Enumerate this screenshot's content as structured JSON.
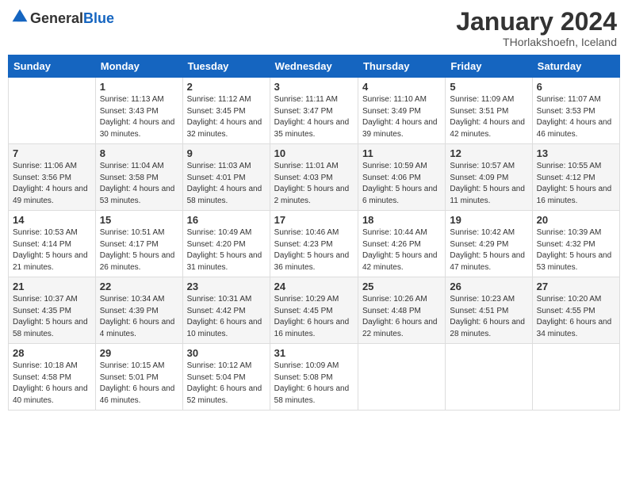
{
  "header": {
    "logo_general": "General",
    "logo_blue": "Blue",
    "month_title": "January 2024",
    "subtitle": "THorlakshoefn, Iceland"
  },
  "weekdays": [
    "Sunday",
    "Monday",
    "Tuesday",
    "Wednesday",
    "Thursday",
    "Friday",
    "Saturday"
  ],
  "weeks": [
    [
      {
        "day": "",
        "sunrise": "",
        "sunset": "",
        "daylight": ""
      },
      {
        "day": "1",
        "sunrise": "Sunrise: 11:13 AM",
        "sunset": "Sunset: 3:43 PM",
        "daylight": "Daylight: 4 hours and 30 minutes."
      },
      {
        "day": "2",
        "sunrise": "Sunrise: 11:12 AM",
        "sunset": "Sunset: 3:45 PM",
        "daylight": "Daylight: 4 hours and 32 minutes."
      },
      {
        "day": "3",
        "sunrise": "Sunrise: 11:11 AM",
        "sunset": "Sunset: 3:47 PM",
        "daylight": "Daylight: 4 hours and 35 minutes."
      },
      {
        "day": "4",
        "sunrise": "Sunrise: 11:10 AM",
        "sunset": "Sunset: 3:49 PM",
        "daylight": "Daylight: 4 hours and 39 minutes."
      },
      {
        "day": "5",
        "sunrise": "Sunrise: 11:09 AM",
        "sunset": "Sunset: 3:51 PM",
        "daylight": "Daylight: 4 hours and 42 minutes."
      },
      {
        "day": "6",
        "sunrise": "Sunrise: 11:07 AM",
        "sunset": "Sunset: 3:53 PM",
        "daylight": "Daylight: 4 hours and 46 minutes."
      }
    ],
    [
      {
        "day": "7",
        "sunrise": "Sunrise: 11:06 AM",
        "sunset": "Sunset: 3:56 PM",
        "daylight": "Daylight: 4 hours and 49 minutes."
      },
      {
        "day": "8",
        "sunrise": "Sunrise: 11:04 AM",
        "sunset": "Sunset: 3:58 PM",
        "daylight": "Daylight: 4 hours and 53 minutes."
      },
      {
        "day": "9",
        "sunrise": "Sunrise: 11:03 AM",
        "sunset": "Sunset: 4:01 PM",
        "daylight": "Daylight: 4 hours and 58 minutes."
      },
      {
        "day": "10",
        "sunrise": "Sunrise: 11:01 AM",
        "sunset": "Sunset: 4:03 PM",
        "daylight": "Daylight: 5 hours and 2 minutes."
      },
      {
        "day": "11",
        "sunrise": "Sunrise: 10:59 AM",
        "sunset": "Sunset: 4:06 PM",
        "daylight": "Daylight: 5 hours and 6 minutes."
      },
      {
        "day": "12",
        "sunrise": "Sunrise: 10:57 AM",
        "sunset": "Sunset: 4:09 PM",
        "daylight": "Daylight: 5 hours and 11 minutes."
      },
      {
        "day": "13",
        "sunrise": "Sunrise: 10:55 AM",
        "sunset": "Sunset: 4:12 PM",
        "daylight": "Daylight: 5 hours and 16 minutes."
      }
    ],
    [
      {
        "day": "14",
        "sunrise": "Sunrise: 10:53 AM",
        "sunset": "Sunset: 4:14 PM",
        "daylight": "Daylight: 5 hours and 21 minutes."
      },
      {
        "day": "15",
        "sunrise": "Sunrise: 10:51 AM",
        "sunset": "Sunset: 4:17 PM",
        "daylight": "Daylight: 5 hours and 26 minutes."
      },
      {
        "day": "16",
        "sunrise": "Sunrise: 10:49 AM",
        "sunset": "Sunset: 4:20 PM",
        "daylight": "Daylight: 5 hours and 31 minutes."
      },
      {
        "day": "17",
        "sunrise": "Sunrise: 10:46 AM",
        "sunset": "Sunset: 4:23 PM",
        "daylight": "Daylight: 5 hours and 36 minutes."
      },
      {
        "day": "18",
        "sunrise": "Sunrise: 10:44 AM",
        "sunset": "Sunset: 4:26 PM",
        "daylight": "Daylight: 5 hours and 42 minutes."
      },
      {
        "day": "19",
        "sunrise": "Sunrise: 10:42 AM",
        "sunset": "Sunset: 4:29 PM",
        "daylight": "Daylight: 5 hours and 47 minutes."
      },
      {
        "day": "20",
        "sunrise": "Sunrise: 10:39 AM",
        "sunset": "Sunset: 4:32 PM",
        "daylight": "Daylight: 5 hours and 53 minutes."
      }
    ],
    [
      {
        "day": "21",
        "sunrise": "Sunrise: 10:37 AM",
        "sunset": "Sunset: 4:35 PM",
        "daylight": "Daylight: 5 hours and 58 minutes."
      },
      {
        "day": "22",
        "sunrise": "Sunrise: 10:34 AM",
        "sunset": "Sunset: 4:39 PM",
        "daylight": "Daylight: 6 hours and 4 minutes."
      },
      {
        "day": "23",
        "sunrise": "Sunrise: 10:31 AM",
        "sunset": "Sunset: 4:42 PM",
        "daylight": "Daylight: 6 hours and 10 minutes."
      },
      {
        "day": "24",
        "sunrise": "Sunrise: 10:29 AM",
        "sunset": "Sunset: 4:45 PM",
        "daylight": "Daylight: 6 hours and 16 minutes."
      },
      {
        "day": "25",
        "sunrise": "Sunrise: 10:26 AM",
        "sunset": "Sunset: 4:48 PM",
        "daylight": "Daylight: 6 hours and 22 minutes."
      },
      {
        "day": "26",
        "sunrise": "Sunrise: 10:23 AM",
        "sunset": "Sunset: 4:51 PM",
        "daylight": "Daylight: 6 hours and 28 minutes."
      },
      {
        "day": "27",
        "sunrise": "Sunrise: 10:20 AM",
        "sunset": "Sunset: 4:55 PM",
        "daylight": "Daylight: 6 hours and 34 minutes."
      }
    ],
    [
      {
        "day": "28",
        "sunrise": "Sunrise: 10:18 AM",
        "sunset": "Sunset: 4:58 PM",
        "daylight": "Daylight: 6 hours and 40 minutes."
      },
      {
        "day": "29",
        "sunrise": "Sunrise: 10:15 AM",
        "sunset": "Sunset: 5:01 PM",
        "daylight": "Daylight: 6 hours and 46 minutes."
      },
      {
        "day": "30",
        "sunrise": "Sunrise: 10:12 AM",
        "sunset": "Sunset: 5:04 PM",
        "daylight": "Daylight: 6 hours and 52 minutes."
      },
      {
        "day": "31",
        "sunrise": "Sunrise: 10:09 AM",
        "sunset": "Sunset: 5:08 PM",
        "daylight": "Daylight: 6 hours and 58 minutes."
      },
      {
        "day": "",
        "sunrise": "",
        "sunset": "",
        "daylight": ""
      },
      {
        "day": "",
        "sunrise": "",
        "sunset": "",
        "daylight": ""
      },
      {
        "day": "",
        "sunrise": "",
        "sunset": "",
        "daylight": ""
      }
    ]
  ]
}
